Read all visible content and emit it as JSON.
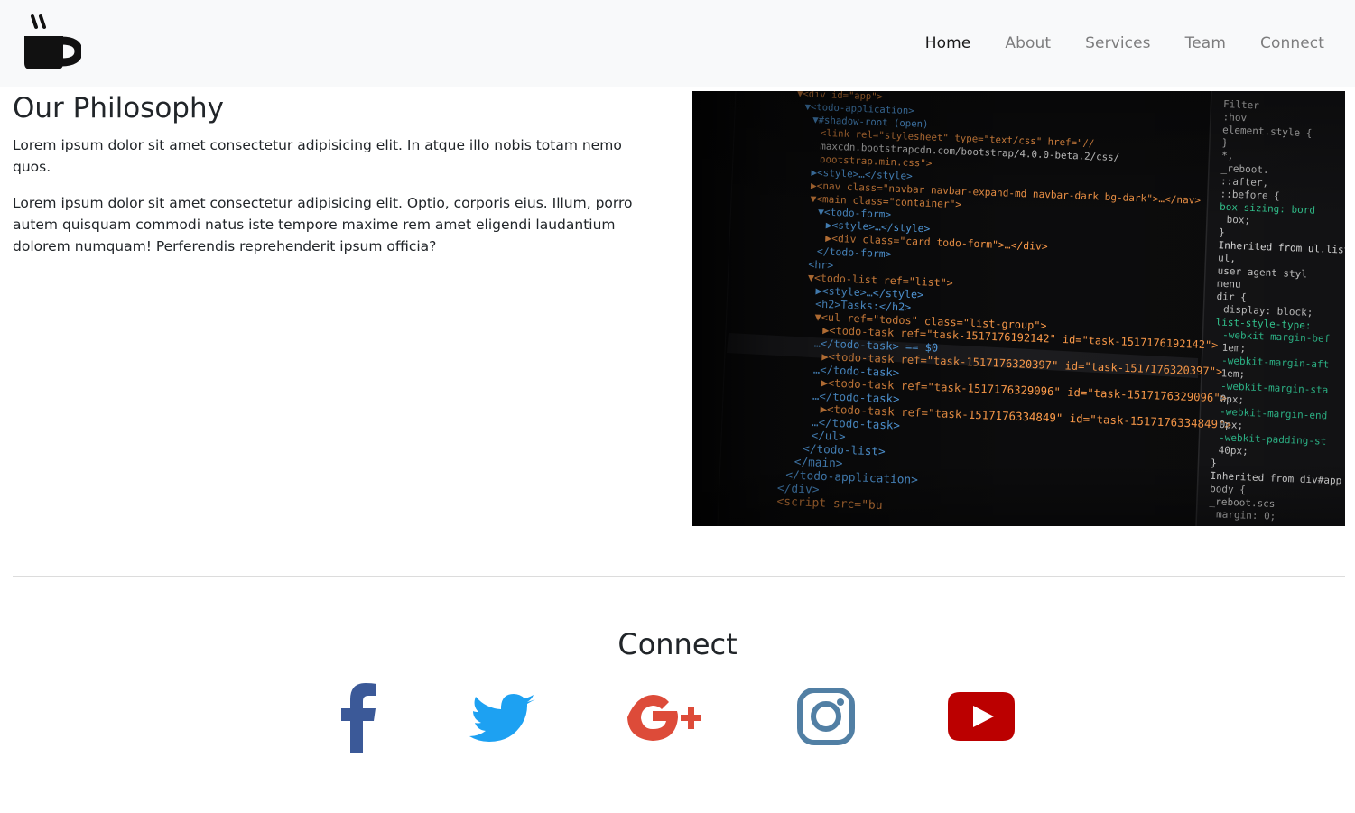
{
  "navbar": {
    "logo_icon": "coffee-mug-icon",
    "links": [
      {
        "label": "Home",
        "active": true
      },
      {
        "label": "About",
        "active": false
      },
      {
        "label": "Services",
        "active": false
      },
      {
        "label": "Team",
        "active": false
      },
      {
        "label": "Connect",
        "active": false
      }
    ]
  },
  "philosophy": {
    "title": "Our Philosophy",
    "paragraphs": [
      "Lorem ipsum dolor sit amet consectetur adipisicing elit. In atque illo nobis totam nemo quos.",
      "Lorem ipsum dolor sit amet consectetur adipisicing elit. Optio, corporis eius. Illum, porro autem quisquam commodi natus iste tempore maxime rem amet eligendi laudantium dolorem numquam! Perferendis reprehenderit ipsum officia?"
    ]
  },
  "code_image": {
    "icon": "code-editor-screenshot",
    "code_lines": [
      "▼<div id=\"app\">",
      "▼<todo-application>",
      "▼#shadow-root (open)",
      "<link rel=\"stylesheet\" type=\"text/css\" href=\"//",
      "maxcdn.bootstrapcdn.com/bootstrap/4.0.0-beta.2/css/",
      "bootstrap.min.css\">",
      "▶<style>…</style>",
      "▶<nav class=\"navbar navbar-expand-md navbar-dark bg-dark\">…</nav>",
      "▼<main class=\"container\">",
      "▼<todo-form>",
      "▶<style>…</style>",
      "▶<div class=\"card todo-form\">…</div>",
      "</todo-form>",
      "<hr>",
      "▼<todo-list ref=\"list\">",
      "▶<style>…</style>",
      "<h2>Tasks:</h2>",
      "▼<ul ref=\"todos\" class=\"list-group\">",
      "▶<todo-task ref=\"task-1517176192142\" id=\"task-1517176192142\">",
      "…</todo-task> == $0",
      "▶<todo-task ref=\"task-1517176320397\" id=\"task-1517176320397\">",
      "…</todo-task>",
      "▶<todo-task ref=\"task-1517176329096\" id=\"task-1517176329096\">",
      "…</todo-task>",
      "▶<todo-task ref=\"task-1517176334849\" id=\"task-1517176334849\">",
      "…</todo-task>",
      "</ul>",
      "</todo-list>",
      "</main>",
      "</todo-application>",
      "</div>",
      "<script src=\"bu"
    ],
    "side_panel_lines": [
      "Filter",
      ":hov",
      "element.style {",
      "}",
      "*,",
      "_reboot.",
      "::after,",
      "::before {",
      "box-sizing: bord",
      "box;",
      "}",
      "Inherited from ul.list",
      "ul,",
      "user agent styl",
      "menu",
      "dir {",
      "display: block;",
      "list-style-type:",
      "-webkit-margin-bef",
      "1em;",
      "-webkit-margin-aft",
      "1em;",
      "-webkit-margin-sta",
      "0px;",
      "-webkit-margin-end",
      "0px;",
      "-webkit-padding-st",
      "40px;",
      "}",
      "Inherited from div#app",
      "body {",
      "_reboot.scs",
      "margin: 0;"
    ]
  },
  "connect": {
    "title": "Connect",
    "socials": [
      {
        "icon": "facebook-icon",
        "color": "#3b5998"
      },
      {
        "icon": "twitter-icon",
        "color": "#1da1f2"
      },
      {
        "icon": "google-plus-icon",
        "color": "#dd4b39"
      },
      {
        "icon": "instagram-icon",
        "color": "#517fa4"
      },
      {
        "icon": "youtube-icon",
        "color": "#bb0000"
      }
    ]
  }
}
